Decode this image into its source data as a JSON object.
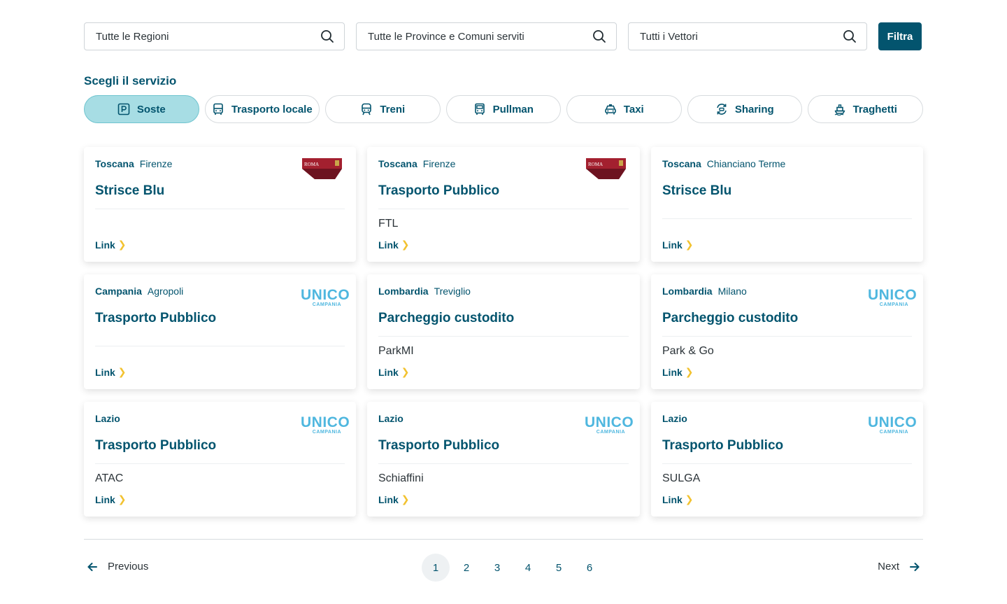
{
  "filters": {
    "regions_placeholder": "Tutte le Regioni",
    "provinces_placeholder": "Tutte le Province e Comuni serviti",
    "carriers_placeholder": "Tutti i Vettori",
    "filter_button": "Filtra"
  },
  "services": {
    "title": "Scegli il servizio",
    "chips": [
      {
        "label": "Soste",
        "icon": "parking-icon",
        "active": true
      },
      {
        "label": "Trasporto locale",
        "icon": "bus-icon",
        "active": false
      },
      {
        "label": "Treni",
        "icon": "train-icon",
        "active": false
      },
      {
        "label": "Pullman",
        "icon": "coach-icon",
        "active": false
      },
      {
        "label": "Taxi",
        "icon": "taxi-icon",
        "active": false
      },
      {
        "label": "Sharing",
        "icon": "sharing-icon",
        "active": false
      },
      {
        "label": "Traghetti",
        "icon": "ferry-icon",
        "active": false
      }
    ]
  },
  "cards": [
    {
      "region": "Toscana",
      "city": "Firenze",
      "title": "Strisce Blu",
      "subtitle": "",
      "link": "Link",
      "logo": "roma"
    },
    {
      "region": "Toscana",
      "city": "Firenze",
      "title": "Trasporto Pubblico",
      "subtitle": "FTL",
      "link": "Link",
      "logo": "roma"
    },
    {
      "region": "Toscana",
      "city": "Chianciano Terme",
      "title": "Strisce Blu",
      "subtitle": "",
      "link": "Link",
      "logo": ""
    },
    {
      "region": "Campania",
      "city": "Agropoli",
      "title": "Trasporto Pubblico",
      "subtitle": "",
      "link": "Link",
      "logo": "unico"
    },
    {
      "region": "Lombardia",
      "city": "Treviglio",
      "title": "Parcheggio custodito",
      "subtitle": "ParkMI",
      "link": "Link",
      "logo": ""
    },
    {
      "region": "Lombardia",
      "city": "Milano",
      "title": "Parcheggio custodito",
      "subtitle": "Park & Go",
      "link": "Link",
      "logo": "unico"
    },
    {
      "region": "Lazio",
      "city": "",
      "title": "Trasporto Pubblico",
      "subtitle": "ATAC",
      "link": "Link",
      "logo": "unico"
    },
    {
      "region": "Lazio",
      "city": "",
      "title": "Trasporto Pubblico",
      "subtitle": "Schiaffini",
      "link": "Link",
      "logo": "unico"
    },
    {
      "region": "Lazio",
      "city": "",
      "title": "Trasporto Pubblico",
      "subtitle": "SULGA",
      "link": "Link",
      "logo": "unico"
    }
  ],
  "logos": {
    "roma_text": "ROMA",
    "unico_main": "UNICO",
    "unico_sub": "CAMPANIA"
  },
  "pagination": {
    "previous": "Previous",
    "next": "Next",
    "pages": [
      "1",
      "2",
      "3",
      "4",
      "5",
      "6"
    ],
    "current": "1"
  },
  "colors": {
    "primary": "#03546e",
    "active_chip": "#a7dde4",
    "link_chevron": "#f2c230",
    "unico_blue": "#4fb7df",
    "roma_red": "#8b1b2a"
  }
}
